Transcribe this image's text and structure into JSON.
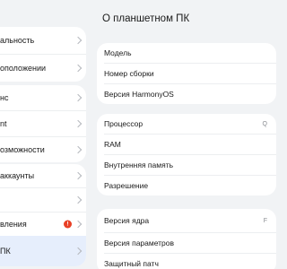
{
  "sidebar": {
    "group1": [
      {
        "label": "альность"
      },
      {
        "label": "оположении"
      }
    ],
    "group2": [
      {
        "label": "нс"
      },
      {
        "label": "nt"
      },
      {
        "label": "озможности"
      }
    ],
    "group3": [
      {
        "label": "аккаунты"
      },
      {
        "label": ""
      },
      {
        "label": "вления",
        "badge": "!"
      },
      {
        "label": "ПК"
      }
    ]
  },
  "main": {
    "title": "О планшетном ПК",
    "card1": [
      {
        "label": "Модель"
      },
      {
        "label": "Номер сборки"
      },
      {
        "label": "Версия HarmonyOS"
      }
    ],
    "card2": [
      {
        "label": "Процессор",
        "value": "Q"
      },
      {
        "label": "RAM"
      },
      {
        "label": "Внутренняя память"
      },
      {
        "label": "Разрешение"
      }
    ],
    "card3": [
      {
        "label": "Версия ядра",
        "value": "F"
      },
      {
        "label": "Версия параметров"
      },
      {
        "label": "Защитный патч"
      }
    ]
  },
  "colors": {
    "background": "#f1f3f5",
    "card": "#ffffff",
    "active_item": "#e6eefc",
    "badge": "#e84026"
  }
}
